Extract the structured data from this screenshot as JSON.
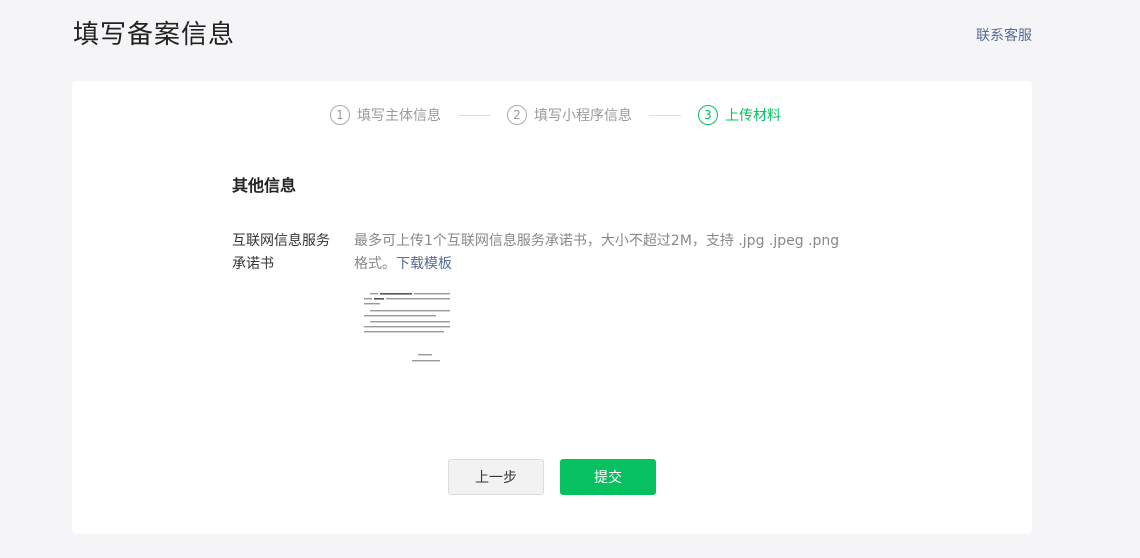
{
  "header": {
    "title": "填写备案信息",
    "contact_label": "联系客服"
  },
  "steps": [
    {
      "number": "1",
      "label": "填写主体信息",
      "active": false
    },
    {
      "number": "2",
      "label": "填写小程序信息",
      "active": false
    },
    {
      "number": "3",
      "label": "上传材料",
      "active": true
    }
  ],
  "section": {
    "title": "其他信息"
  },
  "field": {
    "label": "互联网信息服务承诺书",
    "description": "最多可上传1个互联网信息服务承诺书，大小不超过2M，支持 .jpg .jpeg .png 格式。",
    "download_label": "下载模板"
  },
  "actions": {
    "prev_label": "上一步",
    "submit_label": "提交"
  },
  "colors": {
    "accent": "#07c160",
    "link": "#576b95",
    "background": "#f5f5f7"
  }
}
